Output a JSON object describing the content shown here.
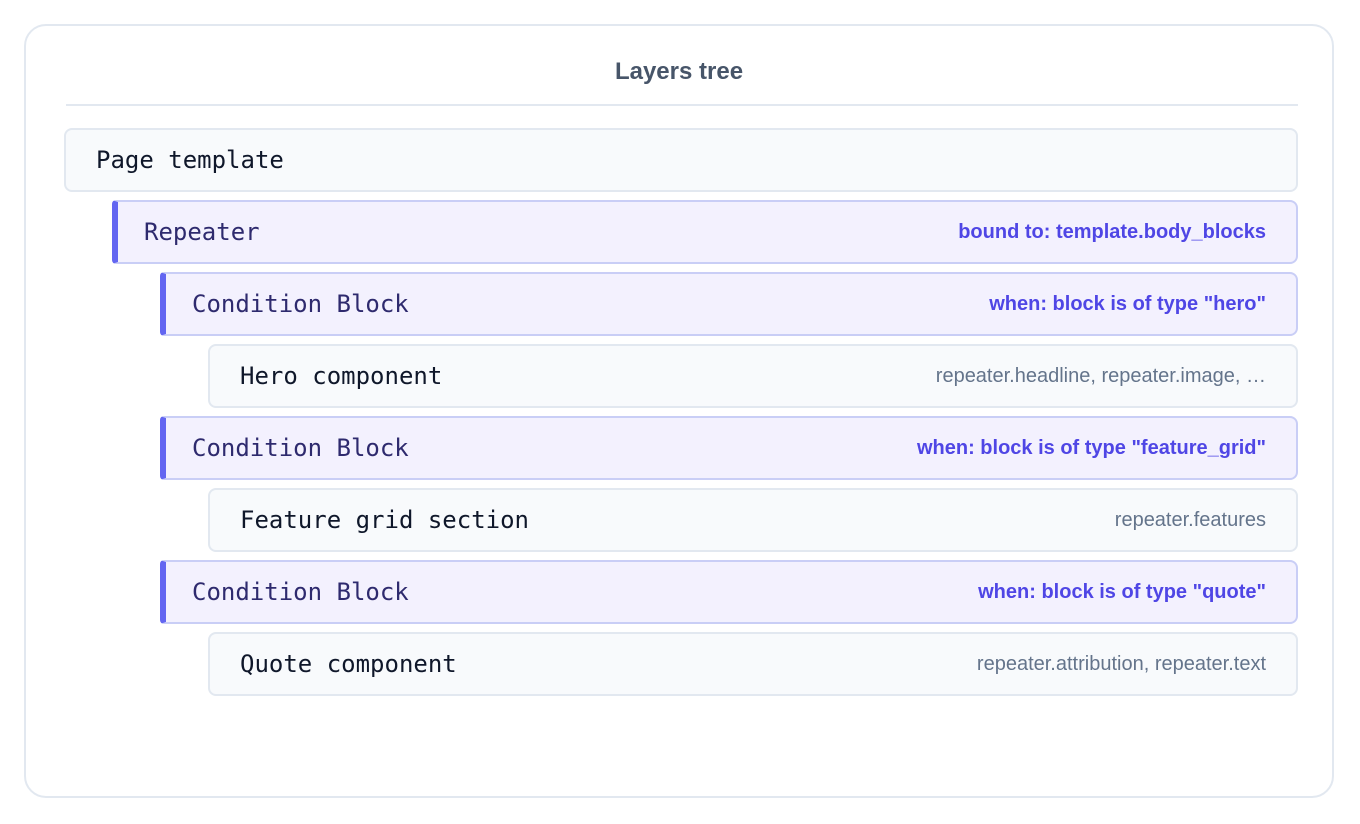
{
  "panel": {
    "title": "Layers tree"
  },
  "tree": [
    {
      "name": "Page template",
      "meta": ""
    },
    {
      "name": "Repeater",
      "meta": "bound to: template.body_blocks"
    },
    {
      "name": "Condition Block",
      "meta": "when: block is of type \"hero\""
    },
    {
      "name": "Hero component",
      "meta": "repeater.headline, repeater.image, …"
    },
    {
      "name": "Condition Block",
      "meta": "when: block is of type \"feature_grid\""
    },
    {
      "name": "Feature grid section",
      "meta": "repeater.features"
    },
    {
      "name": "Condition Block",
      "meta": "when: block is of type \"quote\""
    },
    {
      "name": "Quote component",
      "meta": "repeater.attribution, repeater.text"
    }
  ],
  "colors": {
    "logic_accent": "#6366f1",
    "logic_background": "#f3f1fe",
    "logic_meta_text": "#4f46e5",
    "plain_background": "#f8fafc",
    "plain_meta_text": "#64748b",
    "border": "#e2e8f0"
  }
}
